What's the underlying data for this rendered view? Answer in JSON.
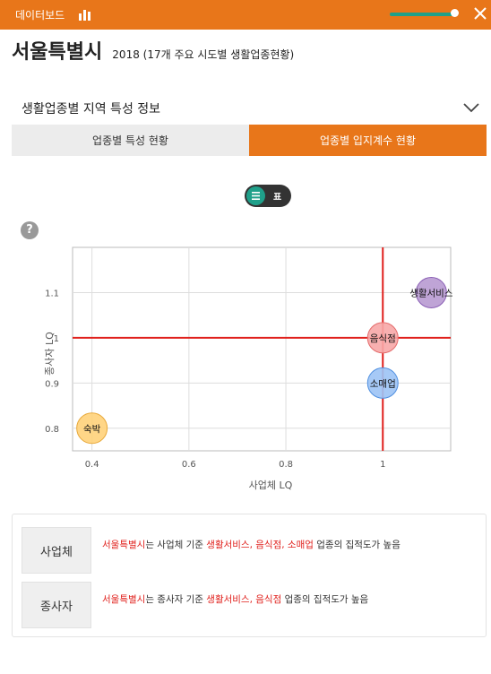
{
  "topbar": {
    "title": "데이터보드",
    "slider_level": 0.95
  },
  "header": {
    "city": "서울특별시",
    "subtitle": "2018 (17개 주요 시도별 생활업종현황)"
  },
  "section": {
    "title": "생활업종별 지역 특성 정보"
  },
  "tabs": [
    {
      "label": "업종별 특성 현황",
      "active": false
    },
    {
      "label": "업종별 입지계수 현황",
      "active": true
    }
  ],
  "toggle": {
    "label": "표"
  },
  "help": {
    "label": "?"
  },
  "chart_data": {
    "type": "scatter",
    "xlabel": "사업체 LQ",
    "ylabel": "종사자 LQ",
    "xlim": [
      0.36,
      1.14
    ],
    "ylim": [
      0.75,
      1.2
    ],
    "xticks": [
      0.4,
      0.6,
      0.8,
      1
    ],
    "yticks": [
      0.8,
      0.9,
      1,
      1.1
    ],
    "xtick_labels": [
      "0.4",
      "0.6",
      "0.8",
      "1"
    ],
    "ytick_labels": [
      "0.8",
      "0.9",
      "1",
      "1.1"
    ],
    "reference_lines": {
      "x": 1,
      "y": 1,
      "color": "#e0201c"
    },
    "grid": true,
    "points": [
      {
        "label": "숙박",
        "x": 0.4,
        "y": 0.8,
        "color": "#ffd27a",
        "stroke": "#e8a93a"
      },
      {
        "label": "음식점",
        "x": 1.0,
        "y": 1.0,
        "color": "#f7a7a7",
        "stroke": "#e46c6c"
      },
      {
        "label": "소매업",
        "x": 1.0,
        "y": 0.9,
        "color": "#9cc3f5",
        "stroke": "#4f8fe0"
      },
      {
        "label": "생활서비스",
        "x": 1.1,
        "y": 1.1,
        "color": "#b89ad1",
        "stroke": "#8a5fb5"
      }
    ]
  },
  "summary": {
    "rows": [
      {
        "badge": "사업체",
        "city": "서울특별시",
        "text1": "는 사업체 기준 ",
        "highlight": "생활서비스, 음식점, 소매업",
        "text2": " 업종의 집적도가 높음"
      },
      {
        "badge": "종사자",
        "city": "서울특별시",
        "text1": "는 종사자 기준 ",
        "highlight": "생활서비스, 음식점",
        "text2": " 업종의 집적도가 높음"
      }
    ]
  }
}
